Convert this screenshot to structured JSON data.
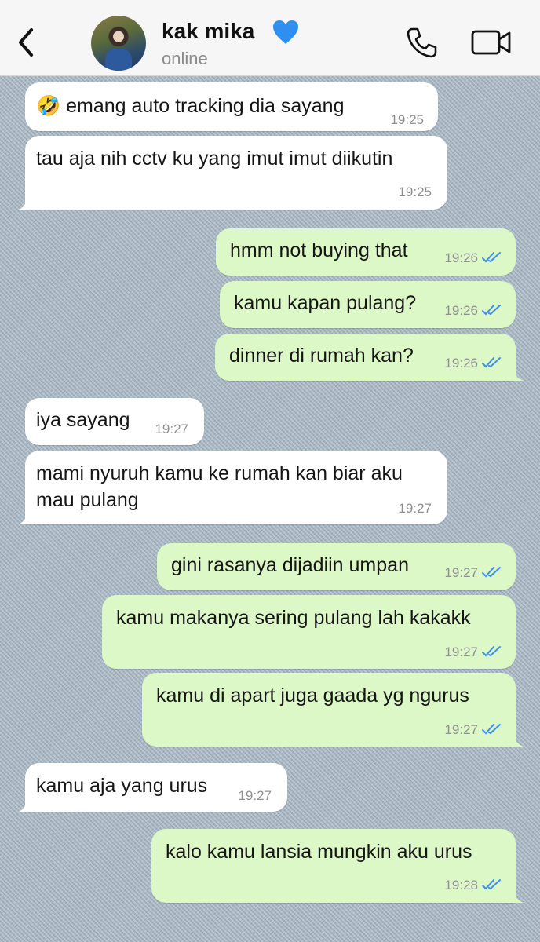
{
  "header": {
    "contact_name": "kak mika",
    "status": "online",
    "heart_color": "#2e8ff0",
    "icons": [
      "back-chevron-icon",
      "phone-icon",
      "video-camera-icon"
    ]
  },
  "messages": [
    {
      "dir": "in",
      "emoji": "🤣",
      "text": "emang auto tracking dia sayang",
      "time": "19:25"
    },
    {
      "dir": "in",
      "text": "tau aja nih cctv ku yang imut imut diikutin",
      "time": "19:25"
    },
    {
      "dir": "out",
      "text": "hmm not buying that",
      "time": "19:26",
      "read": true
    },
    {
      "dir": "out",
      "text": "kamu kapan pulang?",
      "time": "19:26",
      "read": true
    },
    {
      "dir": "out",
      "text": "dinner di rumah kan?",
      "time": "19:26",
      "read": true
    },
    {
      "dir": "in",
      "text": "iya sayang",
      "time": "19:27"
    },
    {
      "dir": "in",
      "text": "mami nyuruh kamu ke rumah kan biar aku mau pulang",
      "time": "19:27"
    },
    {
      "dir": "out",
      "text": "gini rasanya dijadiin umpan",
      "time": "19:27",
      "read": true
    },
    {
      "dir": "out",
      "text": "kamu makanya sering pulang lah kakakk",
      "time": "19:27",
      "read": true
    },
    {
      "dir": "out",
      "text": "kamu di apart juga gaada yg ngurus",
      "time": "19:27",
      "read": true
    },
    {
      "dir": "in",
      "text": "kamu aja yang urus",
      "time": "19:27"
    },
    {
      "dir": "out",
      "text": "kalo kamu lansia mungkin aku urus",
      "time": "19:28",
      "read": true
    }
  ]
}
